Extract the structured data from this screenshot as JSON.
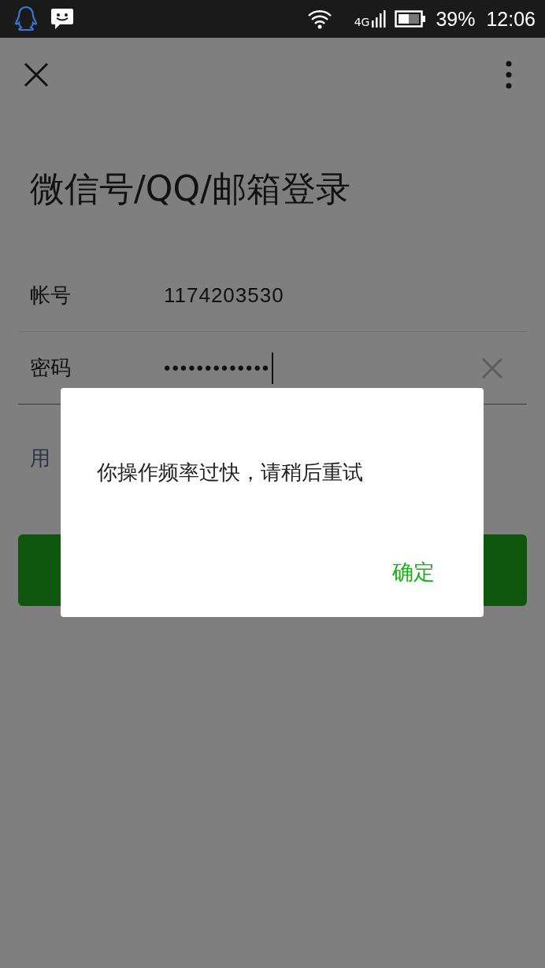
{
  "status_bar": {
    "network": "4G",
    "battery": "39%",
    "time": "12:06"
  },
  "title": "微信号/QQ/邮箱登录",
  "fields": [
    {
      "label": "帐号",
      "value": "1174203530",
      "focused": false
    },
    {
      "label": "密码",
      "value": "•••••••••••••",
      "focused": true
    }
  ],
  "link": "用",
  "dialog": {
    "message": "你操作频率过快，请稍后重试",
    "buttons": [
      "确定"
    ]
  }
}
